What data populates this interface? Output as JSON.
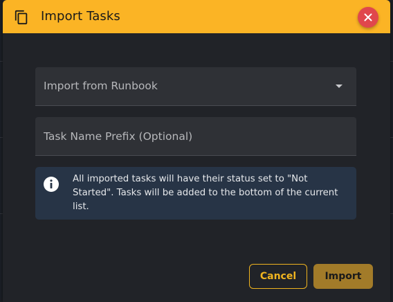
{
  "dialog": {
    "title": "Import Tasks",
    "header_icon": "copy-icon",
    "close_icon": "close-icon"
  },
  "form": {
    "runbook_select": {
      "label": "Import from Runbook",
      "selected_value": "",
      "icon": "chevron-down-icon"
    },
    "prefix_input": {
      "placeholder": "Task Name Prefix (Optional)",
      "value": ""
    }
  },
  "info": {
    "icon": "info-icon",
    "text": "All imported tasks will have their status set to \"Not Started\". Tasks will be added to the bottom of the current list."
  },
  "actions": {
    "cancel_label": "Cancel",
    "import_label": "Import"
  },
  "colors": {
    "header": "#fbb425",
    "close_button": "#e0474c",
    "accent": "#f0b41f",
    "import_button": "#a27b29",
    "info_background": "#273446",
    "dialog_background": "#212328"
  }
}
